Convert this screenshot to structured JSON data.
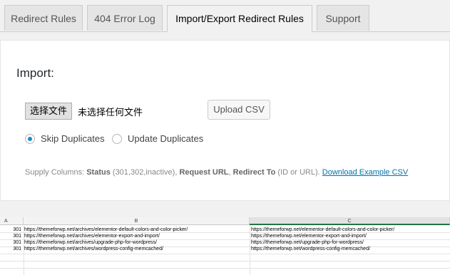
{
  "tabs": [
    {
      "label": "Redirect Rules"
    },
    {
      "label": "404 Error Log"
    },
    {
      "label": "Import/Export Redirect Rules"
    },
    {
      "label": "Support"
    }
  ],
  "import": {
    "heading": "Import:",
    "file_button_label": "选择文件",
    "file_none_label": "未选择任何文件",
    "upload_label": "Upload CSV",
    "options": [
      {
        "label": "Skip Duplicates",
        "selected": true
      },
      {
        "label": "Update Duplicates",
        "selected": false
      }
    ],
    "supply": {
      "prefix": "Supply Columns: ",
      "status_label": "Status",
      "status_values": " (301,302,inactive), ",
      "request_label": "Request URL",
      "sep": ", ",
      "redirect_label": "Redirect To",
      "redirect_note": " (ID or URL). ",
      "download_link": "Download Example CSV"
    }
  },
  "spreadsheet": {
    "columns": [
      "A",
      "B",
      "C"
    ],
    "rows": [
      {
        "a": "301",
        "b": "https://themeforwp.net/archives/elementor-default-colors-and-color-picker/",
        "c": "https://themeforwp.net/elementor-default-colors-and-color-picker/"
      },
      {
        "a": "301",
        "b": "https://themeforwp.net/archives/elementor-export-and-import/",
        "c": "https://themeforwp.net/elementor-export-and-import/"
      },
      {
        "a": "301",
        "b": "https://themeforwp.net/archives/upgrade-php-for-wordpress/",
        "c": "https://themeforwp.net/upgrade-php-for-wordpress/"
      },
      {
        "a": "301",
        "b": "https://themeforwp.net/archives/wordpress-config-memcached/",
        "c": "https://themeforwp.net/wordpress-config-memcached/"
      }
    ]
  }
}
